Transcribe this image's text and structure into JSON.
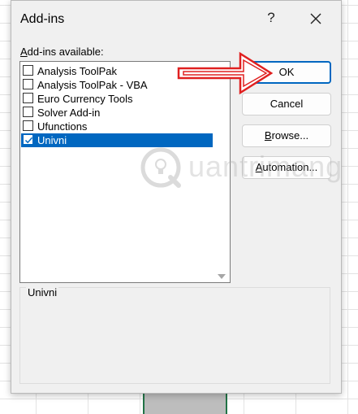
{
  "dialog": {
    "title": "Add-ins",
    "help_label": "?"
  },
  "list": {
    "label_accel": "A",
    "label_rest": "dd-ins available:",
    "items": [
      {
        "label": "Analysis ToolPak",
        "checked": false,
        "selected": false
      },
      {
        "label": "Analysis ToolPak - VBA",
        "checked": false,
        "selected": false
      },
      {
        "label": "Euro Currency Tools",
        "checked": false,
        "selected": false
      },
      {
        "label": "Solver Add-in",
        "checked": false,
        "selected": false
      },
      {
        "label": "Ufunctions",
        "checked": false,
        "selected": false
      },
      {
        "label": "Univni",
        "checked": true,
        "selected": true
      }
    ]
  },
  "buttons": {
    "ok": "OK",
    "cancel": "Cancel",
    "browse_accel": "B",
    "browse_rest": "rowse...",
    "automation_accel": "A",
    "automation_rest": "utomation..."
  },
  "description": {
    "title": "Univni"
  },
  "watermark": {
    "text": "uantrimang"
  },
  "colors": {
    "accent": "#0067c0",
    "annotation": "#e02020"
  }
}
